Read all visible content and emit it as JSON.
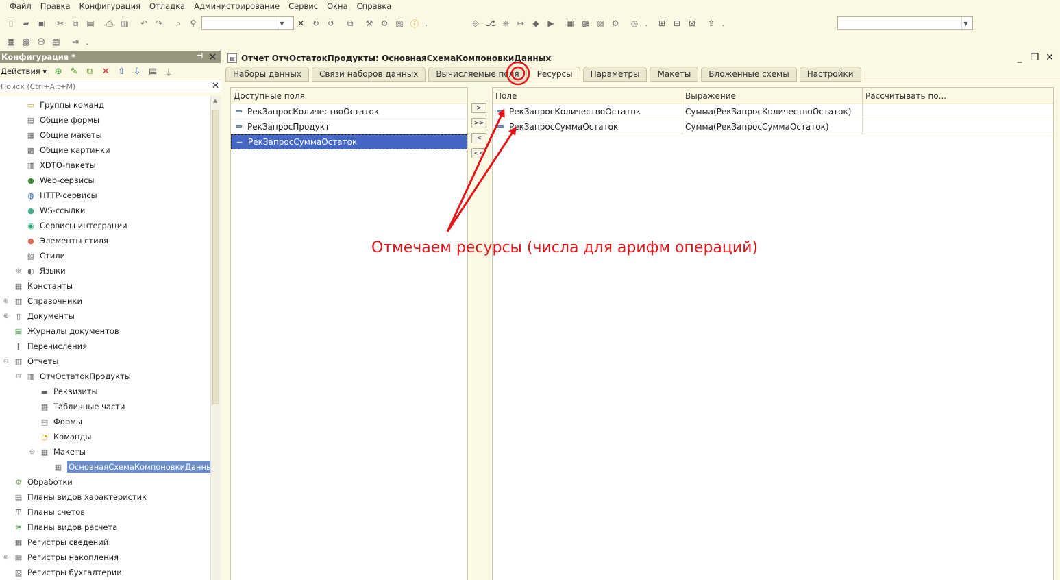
{
  "menu": [
    "Файл",
    "Правка",
    "Конфигурация",
    "Отладка",
    "Администрирование",
    "Сервис",
    "Окна",
    "Справка"
  ],
  "toolbar": {
    "search_value": "",
    "right_combo_value": ""
  },
  "left_panel": {
    "title": "Конфигурация *",
    "actions_label": "Действия",
    "search_placeholder": "Поиск (Ctrl+Alt+M)",
    "tree": [
      {
        "label": "Группы команд",
        "level": 2,
        "icon": "folder-icon"
      },
      {
        "label": "Общие формы",
        "level": 2,
        "icon": "form-icon"
      },
      {
        "label": "Общие макеты",
        "level": 2,
        "icon": "layout-icon"
      },
      {
        "label": "Общие картинки",
        "level": 2,
        "icon": "picture-icon"
      },
      {
        "label": "XDTO-пакеты",
        "level": 2,
        "icon": "package-icon"
      },
      {
        "label": "Web-сервисы",
        "level": 2,
        "icon": "globe-icon"
      },
      {
        "label": "HTTP-сервисы",
        "level": 2,
        "icon": "http-icon"
      },
      {
        "label": "WS-ссылки",
        "level": 2,
        "icon": "link-icon"
      },
      {
        "label": "Сервисы интеграции",
        "level": 2,
        "icon": "integration-icon"
      },
      {
        "label": "Элементы стиля",
        "level": 2,
        "icon": "palette-icon"
      },
      {
        "label": "Стили",
        "level": 2,
        "icon": "style-icon"
      },
      {
        "label": "Языки",
        "level": 2,
        "icon": "language-icon",
        "expandable": true
      },
      {
        "label": "Константы",
        "level": 1,
        "icon": "constant-icon"
      },
      {
        "label": "Справочники",
        "level": 1,
        "icon": "catalog-icon",
        "expandable": true
      },
      {
        "label": "Документы",
        "level": 1,
        "icon": "document-icon",
        "expandable": true
      },
      {
        "label": "Журналы документов",
        "level": 1,
        "icon": "journal-icon"
      },
      {
        "label": "Перечисления",
        "level": 1,
        "icon": "enum-icon"
      },
      {
        "label": "Отчеты",
        "level": 1,
        "icon": "report-icon",
        "expanded": true
      },
      {
        "label": "ОтчОстатокПродукты",
        "level": 2,
        "icon": "report-icon",
        "expanded": true
      },
      {
        "label": "Реквизиты",
        "level": 3,
        "icon": "attribute-icon"
      },
      {
        "label": "Табличные части",
        "level": 3,
        "icon": "table-icon"
      },
      {
        "label": "Формы",
        "level": 3,
        "icon": "form-icon"
      },
      {
        "label": "Команды",
        "level": 3,
        "icon": "command-icon"
      },
      {
        "label": "Макеты",
        "level": 3,
        "icon": "layout-icon",
        "expanded": true
      },
      {
        "label": "ОсновнаяСхемаКомпоновкиДанных",
        "level": 4,
        "icon": "layout-icon",
        "selected": true
      },
      {
        "label": "Обработки",
        "level": 1,
        "icon": "processing-icon"
      },
      {
        "label": "Планы видов характеристик",
        "level": 1,
        "icon": "chart-plan-icon"
      },
      {
        "label": "Планы счетов",
        "level": 1,
        "icon": "accounts-icon"
      },
      {
        "label": "Планы видов расчета",
        "level": 1,
        "icon": "calc-plan-icon"
      },
      {
        "label": "Регистры сведений",
        "level": 1,
        "icon": "register-icon"
      },
      {
        "label": "Регистры накопления",
        "level": 1,
        "icon": "accum-register-icon",
        "expandable": true
      },
      {
        "label": "Регистры бухгалтерии",
        "level": 1,
        "icon": "accounting-register-icon"
      }
    ]
  },
  "main": {
    "title": "Отчет ОтчОстатокПродукты: ОсновнаяСхемаКомпоновкиДанных",
    "tabs": [
      {
        "label": "Наборы данных"
      },
      {
        "label": "Связи наборов данных"
      },
      {
        "label": "Вычисляемые поля"
      },
      {
        "label": "Ресурсы",
        "active": true
      },
      {
        "label": "Параметры"
      },
      {
        "label": "Макеты"
      },
      {
        "label": "Вложенные схемы"
      },
      {
        "label": "Настройки"
      }
    ],
    "available_header": "Доступные поля",
    "available_fields": [
      {
        "name": "РекЗапросКоличествоОстаток"
      },
      {
        "name": "РекЗапросПродукт"
      },
      {
        "name": "РекЗапросСуммаОстаток",
        "selected": true
      }
    ],
    "move_buttons": [
      ">",
      ">>",
      "<",
      "<<"
    ],
    "resource_headers": [
      "Поле",
      "Выражение",
      "Рассчитывать по..."
    ],
    "resources": [
      {
        "field": "РекЗапросКоличествоОстаток",
        "expression": "Сумма(РекЗапросКоличествоОстаток)",
        "calc_by": ""
      },
      {
        "field": "РекЗапросСуммаОстаток",
        "expression": "Сумма(РекЗапросСуммаОстаток)",
        "calc_by": ""
      }
    ]
  },
  "annotation": {
    "text": "Отмечаем ресурсы (числа для арифм операций)",
    "color": "#e3161b"
  }
}
